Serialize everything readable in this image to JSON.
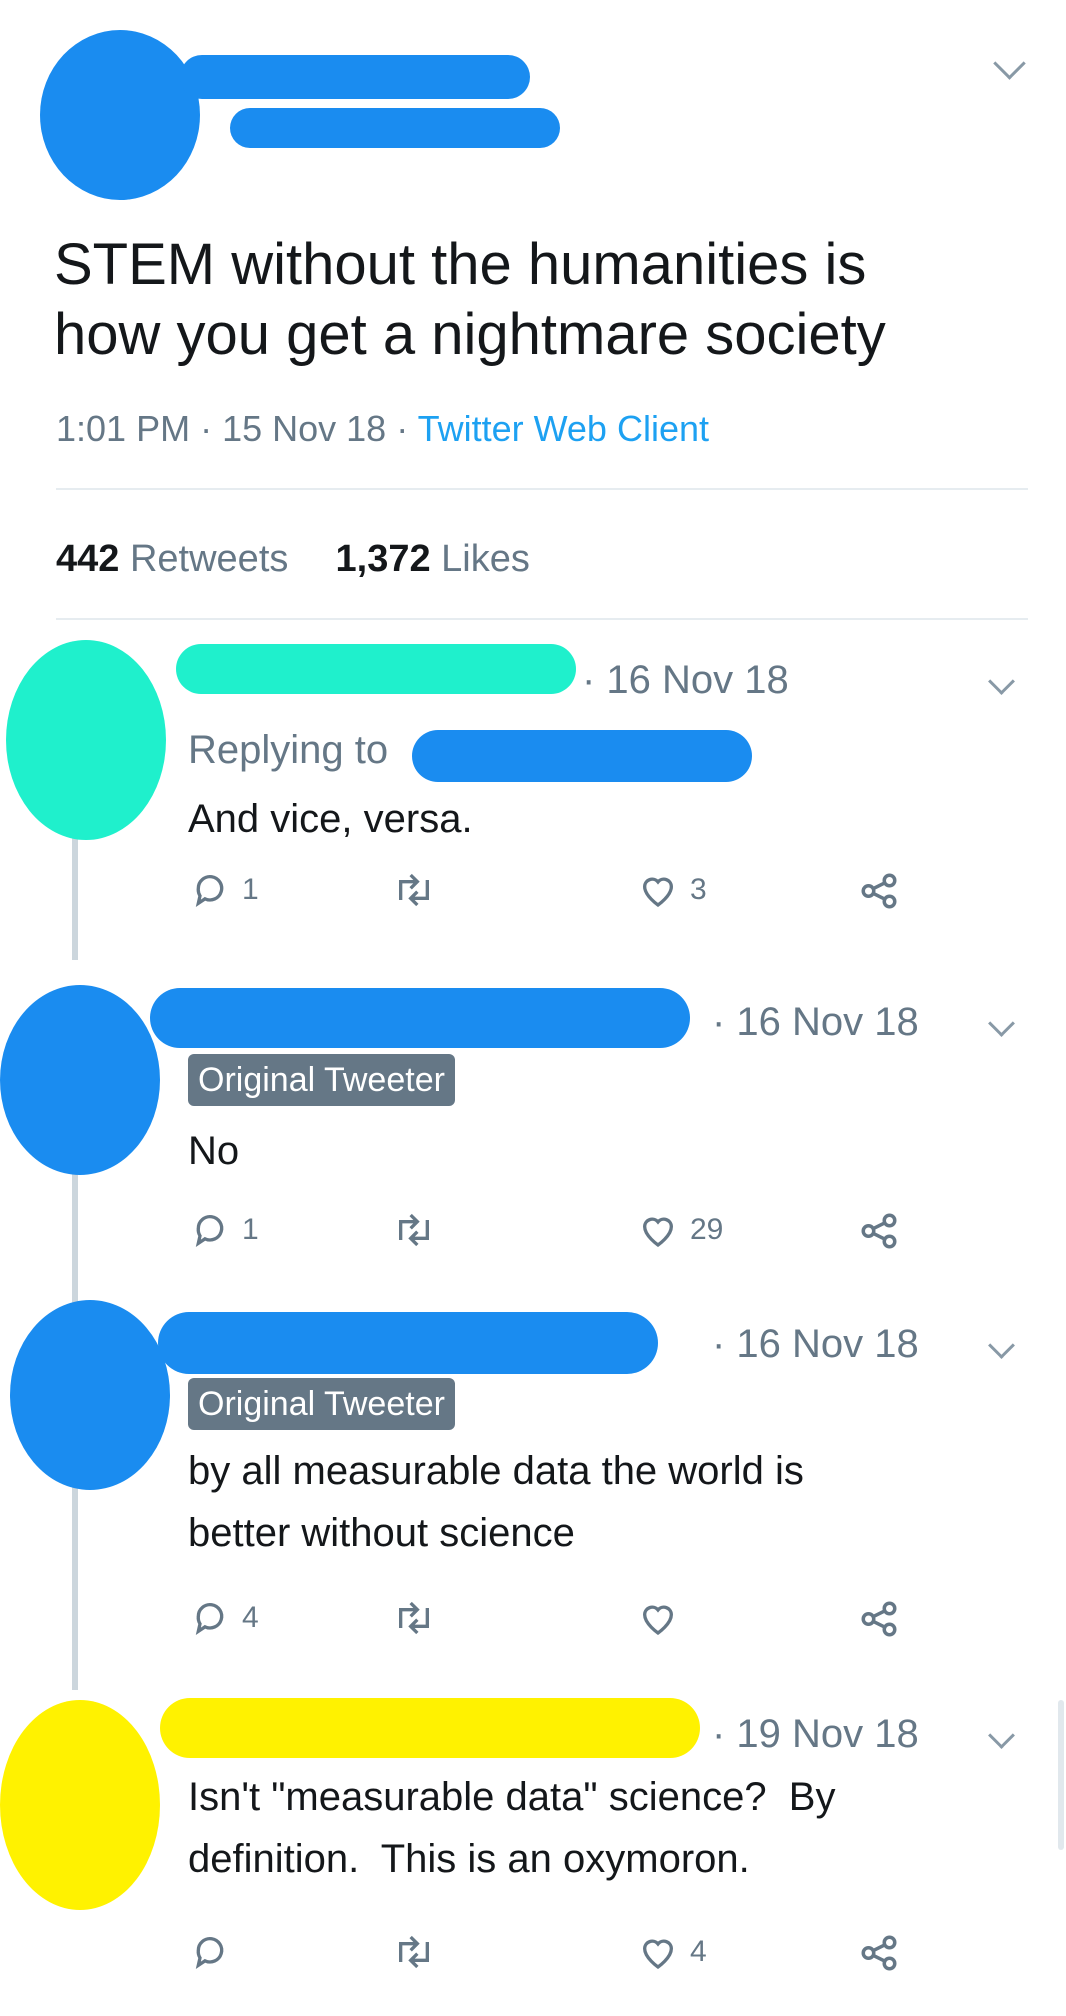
{
  "main_tweet": {
    "text_line1": "STEM without the humanities is",
    "text_line2": "how you get a nightmare society",
    "time": "1:01 PM",
    "date": "15 Nov 18",
    "source": "Twitter Web Client",
    "retweets_count": "442",
    "retweets_label": "Retweets",
    "likes_count": "1,372",
    "likes_label": "Likes",
    "redaction_colors": {
      "avatar": "#1a8cf0",
      "name": "#1a8cf0"
    }
  },
  "replies": [
    {
      "date": "· 16 Nov 18",
      "replying_label": "Replying to",
      "text": "And vice, versa.",
      "reply_count": "1",
      "like_count": "3",
      "redaction_color": "#1ff0cc"
    },
    {
      "date": "· 16 Nov 18",
      "badge": "Original Tweeter",
      "text": "No",
      "reply_count": "1",
      "like_count": "29",
      "redaction_color": "#1a8cf0"
    },
    {
      "date": "· 16 Nov 18",
      "badge": "Original Tweeter",
      "text_line1": "by all measurable data the world is",
      "text_line2": "better without science",
      "reply_count": "4",
      "like_count": "",
      "redaction_color": "#1a8cf0"
    },
    {
      "date": "· 19 Nov 18",
      "text_line1": "Isn't \"measurable data\" science?  By",
      "text_line2": "definition.  This is an oxymoron.",
      "reply_count": "",
      "like_count": "4",
      "redaction_color": "#fff200"
    }
  ],
  "icons": [
    "reply-icon",
    "retweet-icon",
    "like-icon",
    "share-icon",
    "chevron-down-icon"
  ]
}
